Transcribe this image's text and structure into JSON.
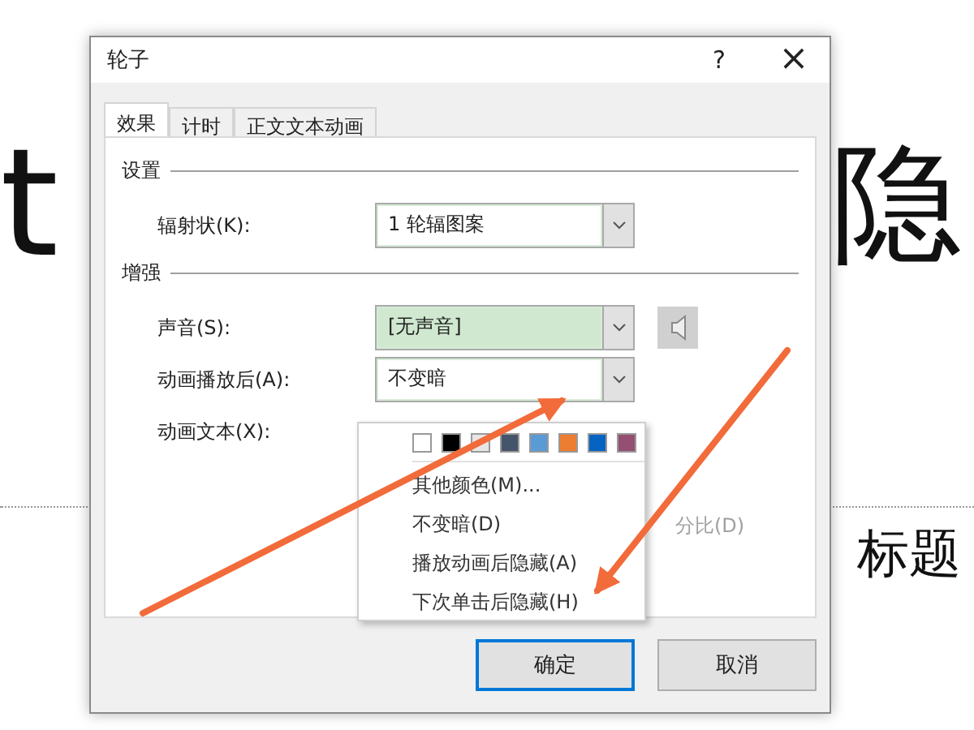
{
  "slide": {
    "title_left": "t",
    "title_right": "隐",
    "subtitle": "标题"
  },
  "dialog": {
    "title": "轮子",
    "help": "?",
    "close": "×",
    "tabs": [
      {
        "label": "效果",
        "selected": true
      },
      {
        "label": "计时",
        "selected": false
      },
      {
        "label": "正文文本动画",
        "selected": false
      }
    ],
    "sections": [
      {
        "title": "设置",
        "rows": [
          {
            "kind": "combo",
            "label": "辐射状(K):",
            "value": "1 轮辐图案",
            "focused": false
          }
        ]
      },
      {
        "title": "增强",
        "rows": [
          {
            "kind": "combo-speaker",
            "label": "声音(S):",
            "value": "[无声音]",
            "focused": true
          },
          {
            "kind": "combo",
            "label": "动画播放后(A):",
            "value": "不变暗",
            "focused": false
          },
          {
            "kind": "label",
            "label": "动画文本(X):"
          }
        ]
      }
    ],
    "disabled_option": "分比(D)",
    "buttons": [
      {
        "label": "确定",
        "selected": true
      },
      {
        "label": "取消",
        "selected": false
      }
    ]
  },
  "menu": {
    "swatches": [
      {
        "color": "#ffffff"
      },
      {
        "color": "#000000"
      },
      {
        "color": "#e7e6e6"
      },
      {
        "color": "#44546a"
      },
      {
        "color": "#5b9bd5"
      },
      {
        "color": "#ed7d31"
      },
      {
        "color": "#0563c1"
      },
      {
        "color": "#954f72"
      }
    ],
    "items": [
      "其他颜色(M)...",
      "不变暗(D)",
      "播放动画后隐藏(A)",
      "下次单击后隐藏(H)"
    ]
  }
}
